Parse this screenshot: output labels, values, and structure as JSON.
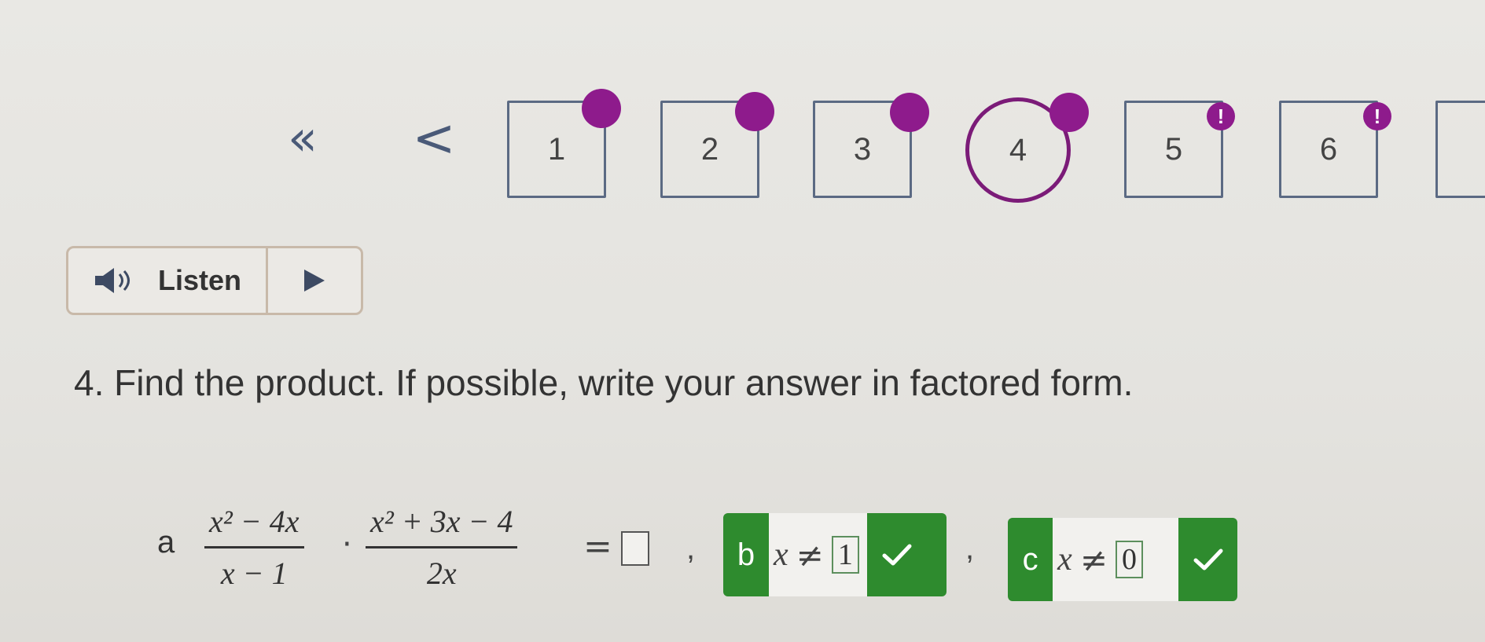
{
  "navigator": {
    "first_icon": "double-chevron-left-icon",
    "prev_icon": "chevron-left-icon",
    "first_glyph": "«",
    "prev_glyph": "<",
    "questions": [
      {
        "label": "1",
        "state": "answered"
      },
      {
        "label": "2",
        "state": "answered"
      },
      {
        "label": "3",
        "state": "answered"
      },
      {
        "label": "4",
        "state": "current-answered"
      },
      {
        "label": "5",
        "state": "flagged"
      },
      {
        "label": "6",
        "state": "flagged"
      },
      {
        "label": "",
        "state": "partial"
      }
    ],
    "flag_glyph": "!"
  },
  "listen": {
    "label": "Listen",
    "speaker_icon": "speaker-icon",
    "play_icon": "play-icon"
  },
  "question": {
    "text": "4. Find the product. If possible, write your answer in factored form."
  },
  "answer_row": {
    "part_a": {
      "letter": "a",
      "frac1_num": "x² − 4x",
      "frac1_den": "x − 1",
      "dot": "·",
      "frac2_num": "x² + 3x − 4",
      "frac2_den": "2x",
      "equals": "="
    },
    "separator": ",",
    "part_b": {
      "letter": "b",
      "variable": "x",
      "relation": "≠",
      "value": "1",
      "status": "correct"
    },
    "part_c": {
      "letter": "c",
      "variable": "x",
      "relation": "≠",
      "value": "0",
      "status": "correct"
    }
  },
  "colors": {
    "accent_purple": "#8e1b8c",
    "correct_green": "#2e8b2e",
    "nav_border": "#5b6a83"
  }
}
